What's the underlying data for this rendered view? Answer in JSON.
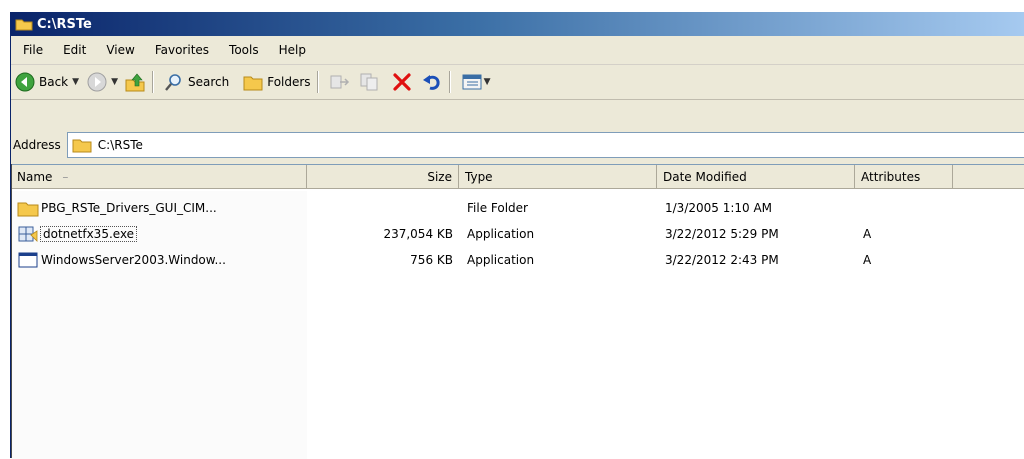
{
  "window": {
    "title": "C:\\RSTe"
  },
  "menu": {
    "file": "File",
    "edit": "Edit",
    "view": "View",
    "favorites": "Favorites",
    "tools": "Tools",
    "help": "Help"
  },
  "toolbar": {
    "back": "Back",
    "search": "Search",
    "folders": "Folders"
  },
  "address": {
    "label": "Address",
    "path": "C:\\RSTe"
  },
  "columns": {
    "name": "Name",
    "size": "Size",
    "type": "Type",
    "date": "Date Modified",
    "attributes": "Attributes"
  },
  "files": [
    {
      "name": "PBG_RSTe_Drivers_GUI_CIM...",
      "size": "",
      "type": "File Folder",
      "date": "1/3/2005 1:10 AM",
      "attr": "",
      "icon": "folder-icon"
    },
    {
      "name": "dotnetfx35.exe",
      "size": "237,054 KB",
      "type": "Application",
      "date": "3/22/2012 5:29 PM",
      "attr": "A",
      "icon": "installer-icon"
    },
    {
      "name": "WindowsServer2003.Window...",
      "size": "756 KB",
      "type": "Application",
      "date": "3/22/2012 2:43 PM",
      "attr": "A",
      "icon": "application-icon"
    }
  ],
  "colors": {
    "titlebar_start": "#0a246a",
    "titlebar_end": "#a6caf0",
    "chrome": "#ece9d8",
    "delete_red": "#e01010"
  }
}
